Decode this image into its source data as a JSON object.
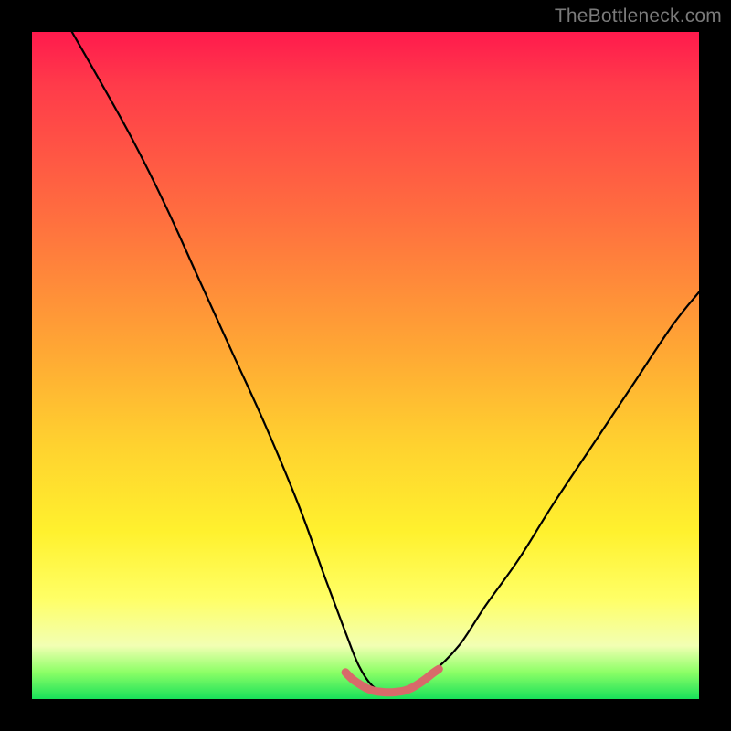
{
  "watermark": "TheBottleneck.com",
  "chart_data": {
    "type": "line",
    "title": "",
    "xlabel": "",
    "ylabel": "",
    "xlim": [
      0,
      100
    ],
    "ylim": [
      0,
      100
    ],
    "grid": false,
    "legend": false,
    "series": [
      {
        "name": "bottleneck-curve",
        "color": "#000000",
        "x": [
          6,
          10,
          15,
          20,
          25,
          30,
          35,
          40,
          44,
          47,
          49,
          51,
          53,
          55,
          57,
          60,
          64,
          68,
          73,
          78,
          84,
          90,
          96,
          100
        ],
        "y": [
          100,
          93,
          84,
          74,
          63,
          52,
          41,
          29,
          18,
          10,
          5,
          2,
          1,
          1,
          2,
          4,
          8,
          14,
          21,
          29,
          38,
          47,
          56,
          61
        ]
      },
      {
        "name": "optimal-flat-region",
        "color": "#d86a6a",
        "x": [
          47,
          48,
          49,
          50,
          51,
          52,
          53,
          54,
          55,
          56,
          57,
          58,
          59,
          60,
          61
        ],
        "y": [
          4,
          3,
          2.3,
          1.7,
          1.3,
          1.1,
          1,
          1,
          1.1,
          1.3,
          1.7,
          2.3,
          3,
          3.8,
          4.5
        ]
      }
    ],
    "annotations": []
  },
  "colors": {
    "background": "#000000",
    "gradient_top": "#ff1a4d",
    "gradient_mid": "#ffd22f",
    "gradient_bottom": "#18e05a",
    "curve": "#000000",
    "marker": "#d86a6a"
  }
}
